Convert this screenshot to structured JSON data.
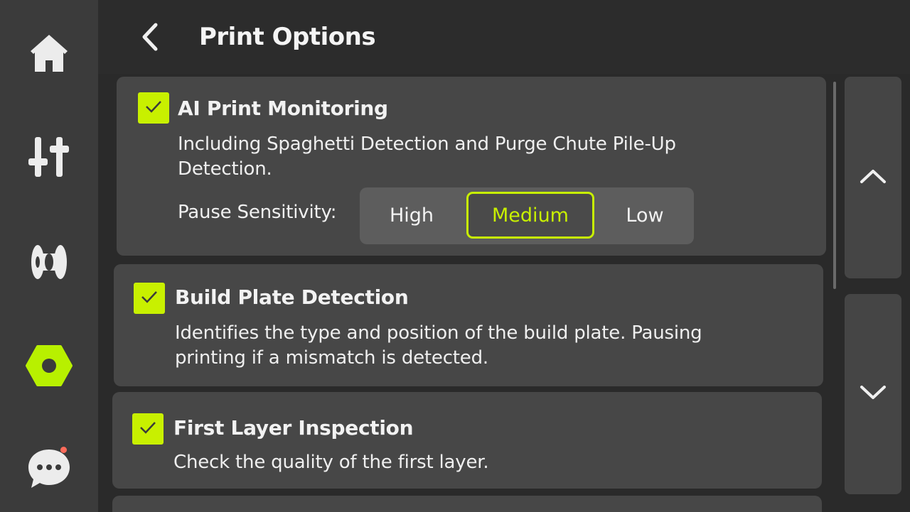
{
  "header": {
    "title": "Print Options"
  },
  "sidebar": {
    "items": [
      {
        "icon": "home-icon"
      },
      {
        "icon": "controls-icon"
      },
      {
        "icon": "filament-icon"
      },
      {
        "icon": "settings-hex-icon",
        "active": true
      },
      {
        "icon": "chat-icon",
        "has_notification": true
      }
    ]
  },
  "options": [
    {
      "title": "AI Print Monitoring",
      "checked": true,
      "description_line1": "Including Spaghetti Detection and Purge Chute Pile-Up",
      "description_line2": "Detection.",
      "sensitivity_label": "Pause Sensitivity:",
      "sensitivity_options": [
        "High",
        "Medium",
        "Low"
      ],
      "sensitivity_selected": "Medium"
    },
    {
      "title": "Build Plate Detection",
      "checked": true,
      "description_line1": "Identifies the type and position of the build plate. Pausing",
      "description_line2": "printing if a mismatch is detected."
    },
    {
      "title": "First Layer Inspection",
      "checked": true,
      "description_line1": "Check the quality of the first layer."
    }
  ],
  "colors": {
    "accent": "#c8f000",
    "notification": "#ff6b5a",
    "background": "#2a2a2a",
    "card": "#474747",
    "sidebar": "#3b3b3b"
  }
}
